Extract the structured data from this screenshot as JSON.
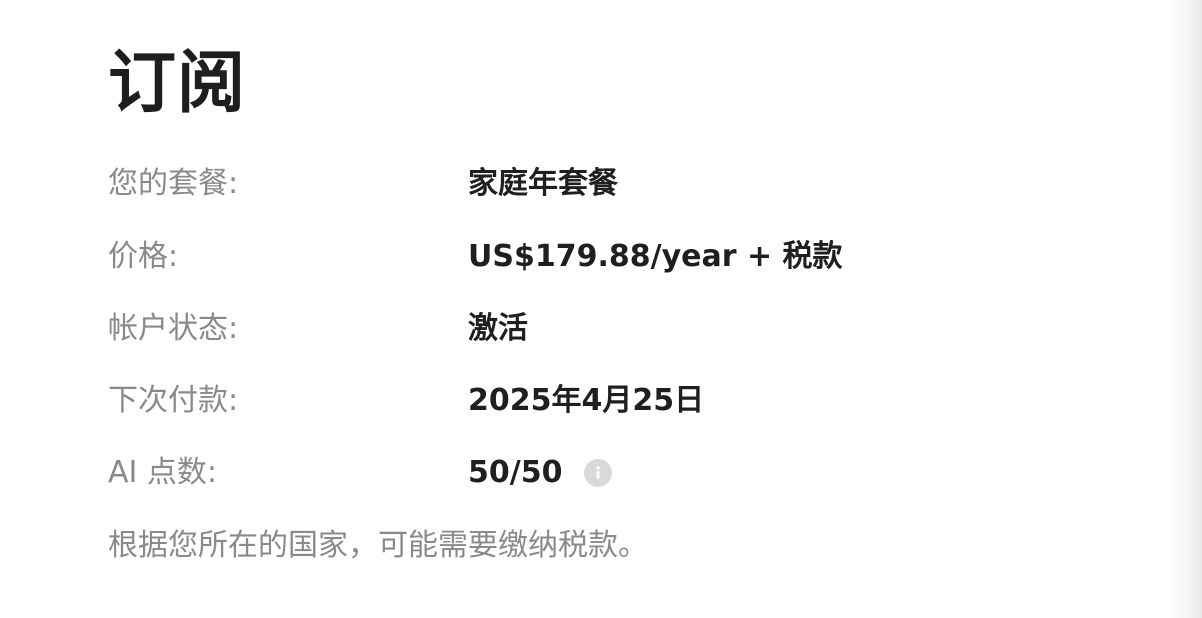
{
  "page_title": "订阅",
  "rows": [
    {
      "label": "您的套餐:",
      "value": "家庭年套餐"
    },
    {
      "label": "价格:",
      "value": "US$179.88/year + 税款"
    },
    {
      "label": "帐户状态:",
      "value": "激活"
    },
    {
      "label": "下次付款:",
      "value": "2025年4月25日"
    },
    {
      "label": "AI 点数:",
      "value": "50/50",
      "icon": "info-icon"
    }
  ],
  "note": "根据您所在的国家，可能需要缴纳税款。",
  "colors": {
    "title": "#1e1e1e",
    "label": "#8a8a8a",
    "value": "#1f1f1f",
    "icon_bg": "#d9d9d9"
  }
}
